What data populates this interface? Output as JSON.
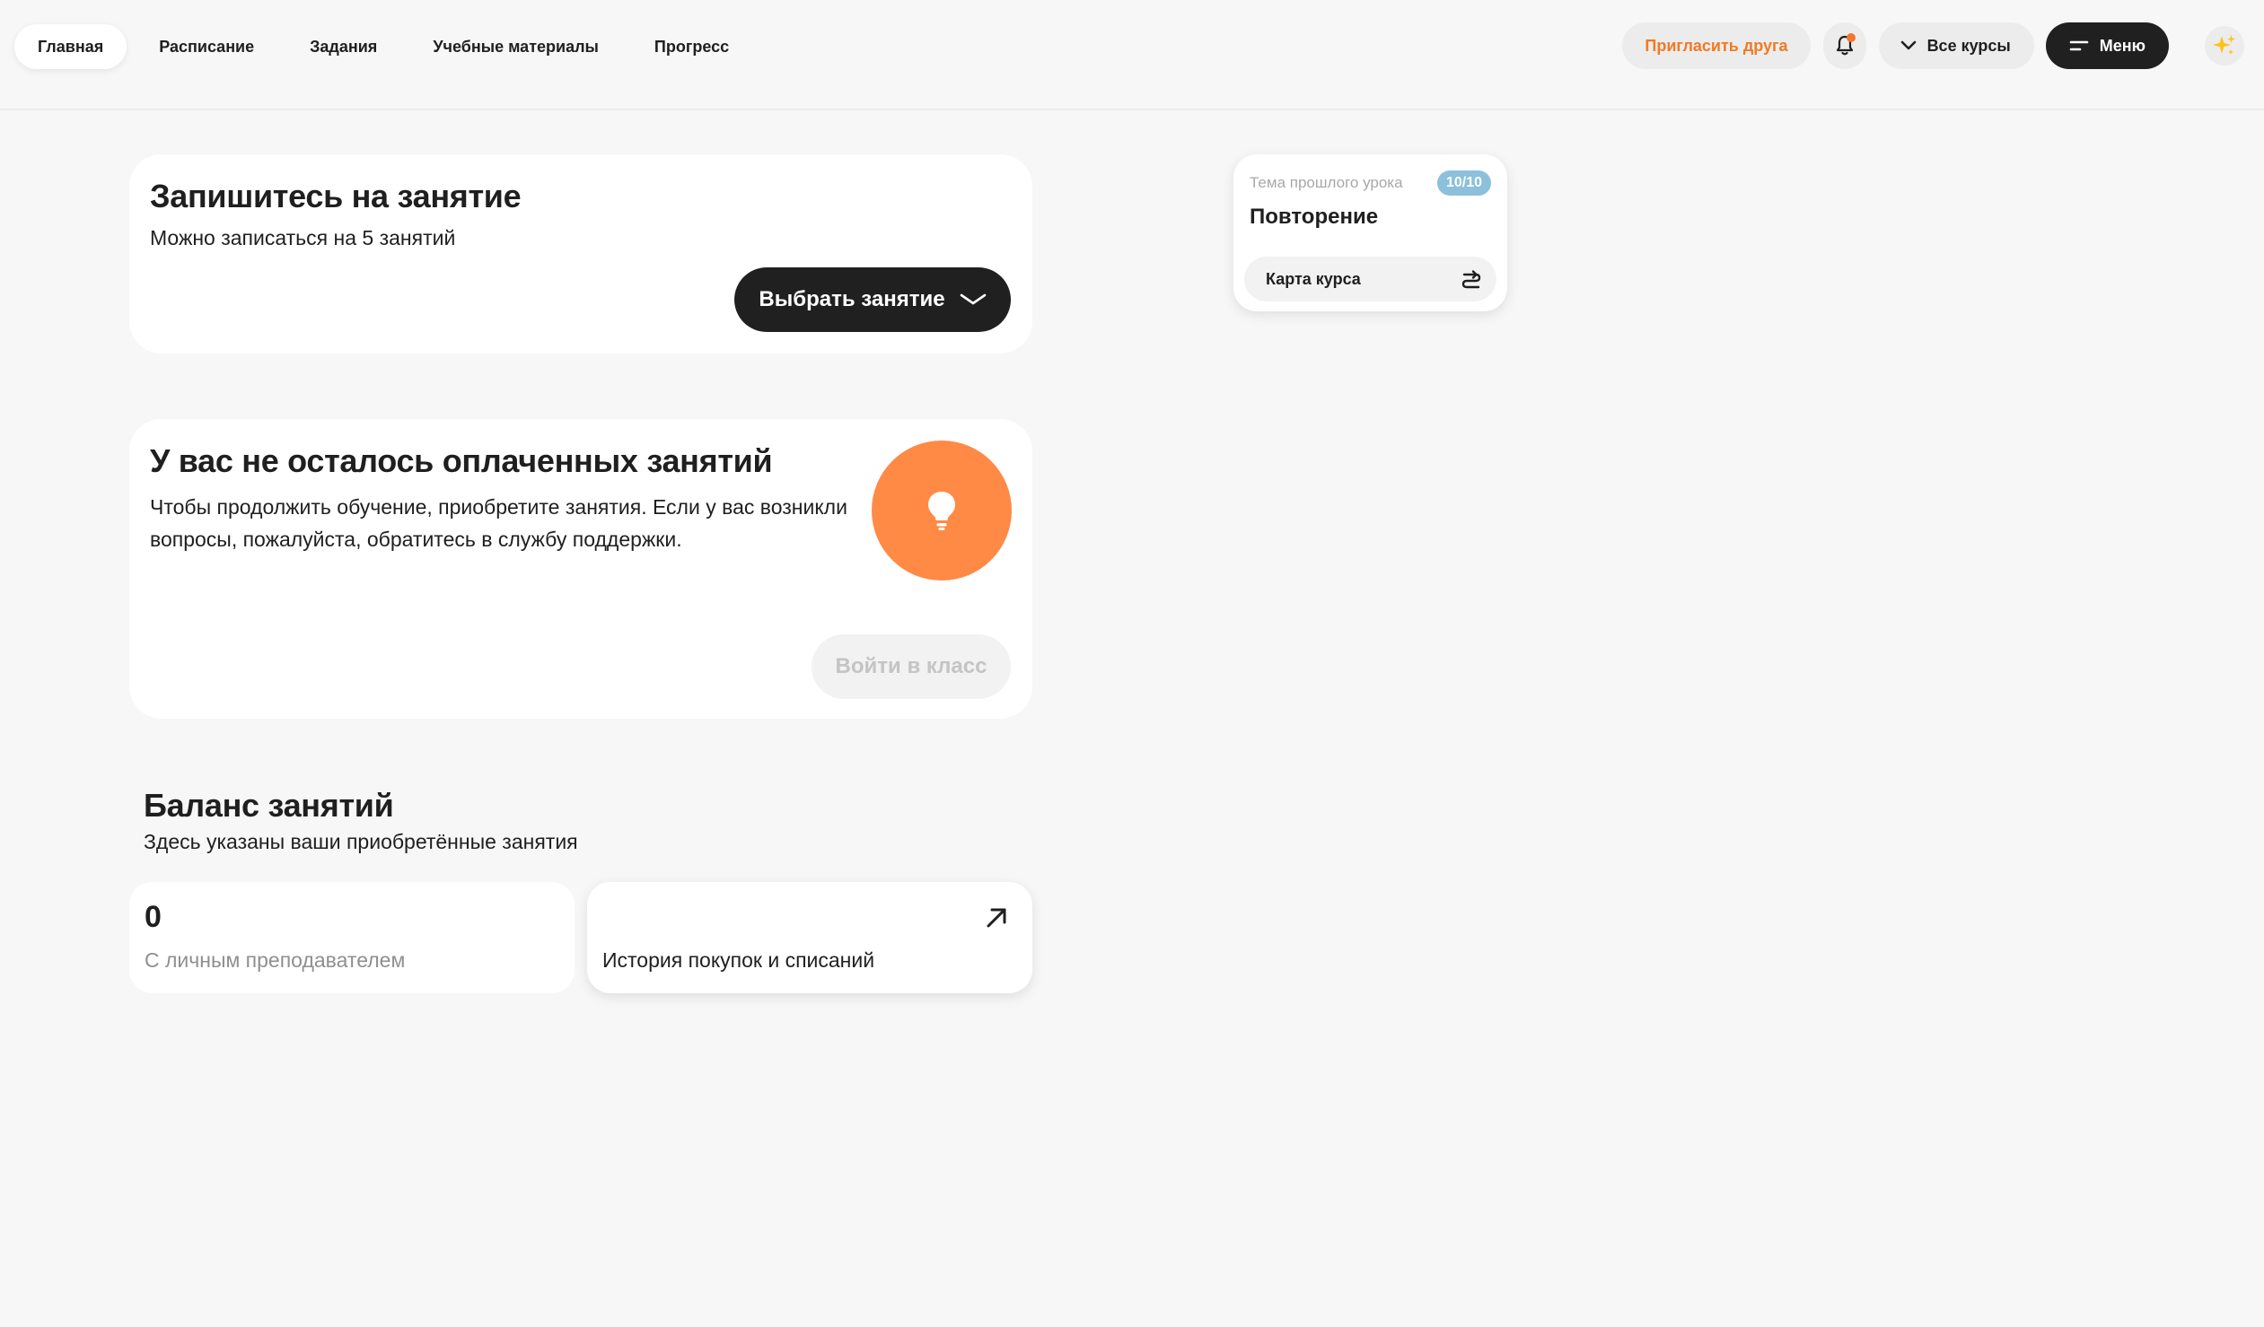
{
  "nav": {
    "items": [
      {
        "label": "Главная",
        "active": true
      },
      {
        "label": "Расписание",
        "active": false
      },
      {
        "label": "Задания",
        "active": false
      },
      {
        "label": "Учебные материалы",
        "active": false
      },
      {
        "label": "Прогресс",
        "active": false
      }
    ]
  },
  "header": {
    "invite_label": "Пригласить друга",
    "bell_icon": "bell-icon",
    "courses_label": "Все курсы",
    "menu_label": "Меню",
    "sparkle_icon": "sparkle-icon"
  },
  "signup": {
    "title": "Запишитесь на занятие",
    "subtitle": "Можно записаться на 5 занятий",
    "button_label": "Выбрать занятие"
  },
  "nopaid": {
    "title": "У вас не осталось оплаченных занятий",
    "text": "Чтобы продолжить обучение, приобретите занятия. Если у вас возникли вопросы, пожалуйста, обратитесь в службу поддержки.",
    "icon": "lightbulb-icon",
    "button_label": "Войти в класс"
  },
  "balance": {
    "title": "Баланс занятий",
    "subtitle": "Здесь указаны ваши приобретённые занятия",
    "count": "0",
    "count_label": "С личным преподавателем",
    "history_label": "История покупок и списаний"
  },
  "last_lesson": {
    "caption": "Тема прошлого урока",
    "score": "10/10",
    "name": "Повторение",
    "map_label": "Карта курса"
  },
  "colors": {
    "accent_orange": "#ff8a45",
    "invite_text": "#f07a25",
    "dark_button": "#202020",
    "badge_blue": "#8cc0dc"
  }
}
